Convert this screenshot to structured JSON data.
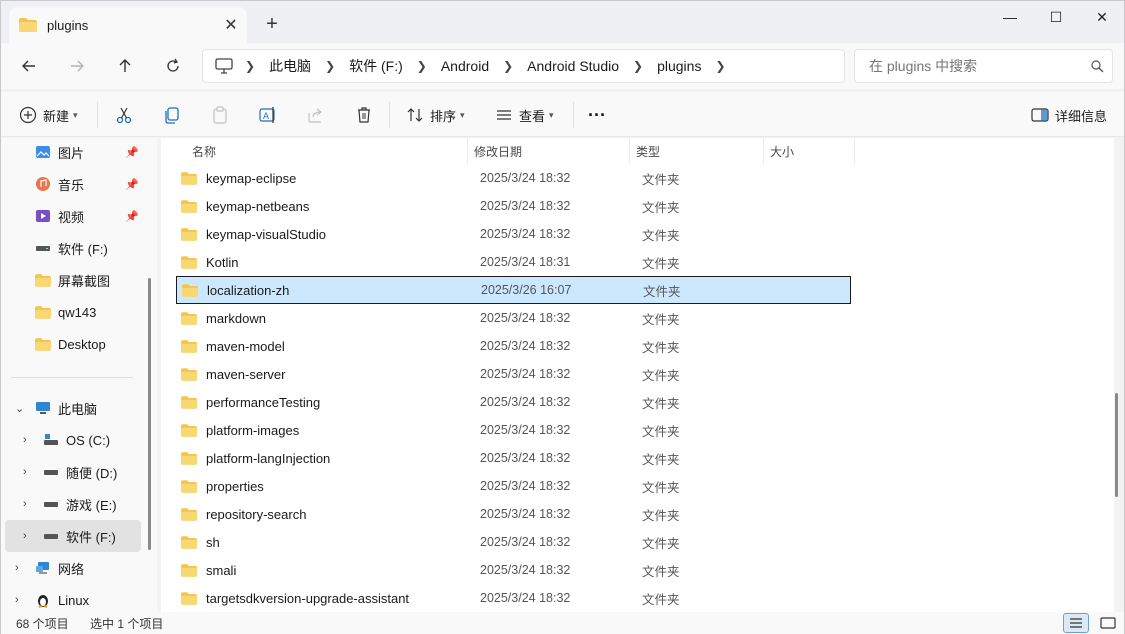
{
  "window": {
    "tab_title": "plugins",
    "tab_close": "✕",
    "new_tab": "+",
    "minimize": "—",
    "maximize": "☐",
    "close": "✕"
  },
  "address": {
    "crumbs": [
      "此电脑",
      "软件 (F:)",
      "Android",
      "Android Studio",
      "plugins"
    ],
    "search_placeholder": "在 plugins 中搜索"
  },
  "toolbar": {
    "new_label": "新建",
    "sort_label": "排序",
    "view_label": "查看",
    "more_label": "···",
    "details_label": "详细信息"
  },
  "sidebar": {
    "quick_access": [
      {
        "label": "图片",
        "icon": "pictures-icon",
        "pinned": true
      },
      {
        "label": "音乐",
        "icon": "music-icon",
        "pinned": true
      },
      {
        "label": "视频",
        "icon": "video-icon",
        "pinned": true
      },
      {
        "label": "软件 (F:)",
        "icon": "drive-icon",
        "pinned": false
      },
      {
        "label": "屏幕截图",
        "icon": "folder-icon",
        "pinned": false
      },
      {
        "label": "qw143",
        "icon": "folder-icon",
        "pinned": false
      },
      {
        "label": "Desktop",
        "icon": "folder-icon",
        "pinned": false
      }
    ],
    "this_pc_label": "此电脑",
    "drives": [
      {
        "label": "OS (C:)",
        "icon": "os-drive-icon"
      },
      {
        "label": "随便 (D:)",
        "icon": "drive-icon"
      },
      {
        "label": "游戏 (E:)",
        "icon": "drive-icon"
      },
      {
        "label": "软件 (F:)",
        "icon": "drive-icon",
        "selected": true
      }
    ],
    "network_label": "网络",
    "linux_label": "Linux"
  },
  "columns": {
    "name": "名称",
    "date": "修改日期",
    "type": "类型",
    "size": "大小"
  },
  "files": [
    {
      "name": "keymap-eclipse",
      "date": "2025/3/24 18:32",
      "type": "文件夹"
    },
    {
      "name": "keymap-netbeans",
      "date": "2025/3/24 18:32",
      "type": "文件夹"
    },
    {
      "name": "keymap-visualStudio",
      "date": "2025/3/24 18:32",
      "type": "文件夹"
    },
    {
      "name": "Kotlin",
      "date": "2025/3/24 18:31",
      "type": "文件夹"
    },
    {
      "name": "localization-zh",
      "date": "2025/3/26 16:07",
      "type": "文件夹",
      "selected": true
    },
    {
      "name": "markdown",
      "date": "2025/3/24 18:32",
      "type": "文件夹"
    },
    {
      "name": "maven-model",
      "date": "2025/3/24 18:32",
      "type": "文件夹"
    },
    {
      "name": "maven-server",
      "date": "2025/3/24 18:32",
      "type": "文件夹"
    },
    {
      "name": "performanceTesting",
      "date": "2025/3/24 18:32",
      "type": "文件夹"
    },
    {
      "name": "platform-images",
      "date": "2025/3/24 18:32",
      "type": "文件夹"
    },
    {
      "name": "platform-langInjection",
      "date": "2025/3/24 18:32",
      "type": "文件夹"
    },
    {
      "name": "properties",
      "date": "2025/3/24 18:32",
      "type": "文件夹"
    },
    {
      "name": "repository-search",
      "date": "2025/3/24 18:32",
      "type": "文件夹"
    },
    {
      "name": "sh",
      "date": "2025/3/24 18:32",
      "type": "文件夹"
    },
    {
      "name": "smali",
      "date": "2025/3/24 18:32",
      "type": "文件夹"
    },
    {
      "name": "targetsdkversion-upgrade-assistant",
      "date": "2025/3/24 18:32",
      "type": "文件夹"
    }
  ],
  "status": {
    "item_count": "68 个项目",
    "selection": "选中 1 个项目"
  },
  "colors": {
    "folder": "#f4c54a",
    "selection": "#cce8ff",
    "accent": "#0067c0"
  }
}
